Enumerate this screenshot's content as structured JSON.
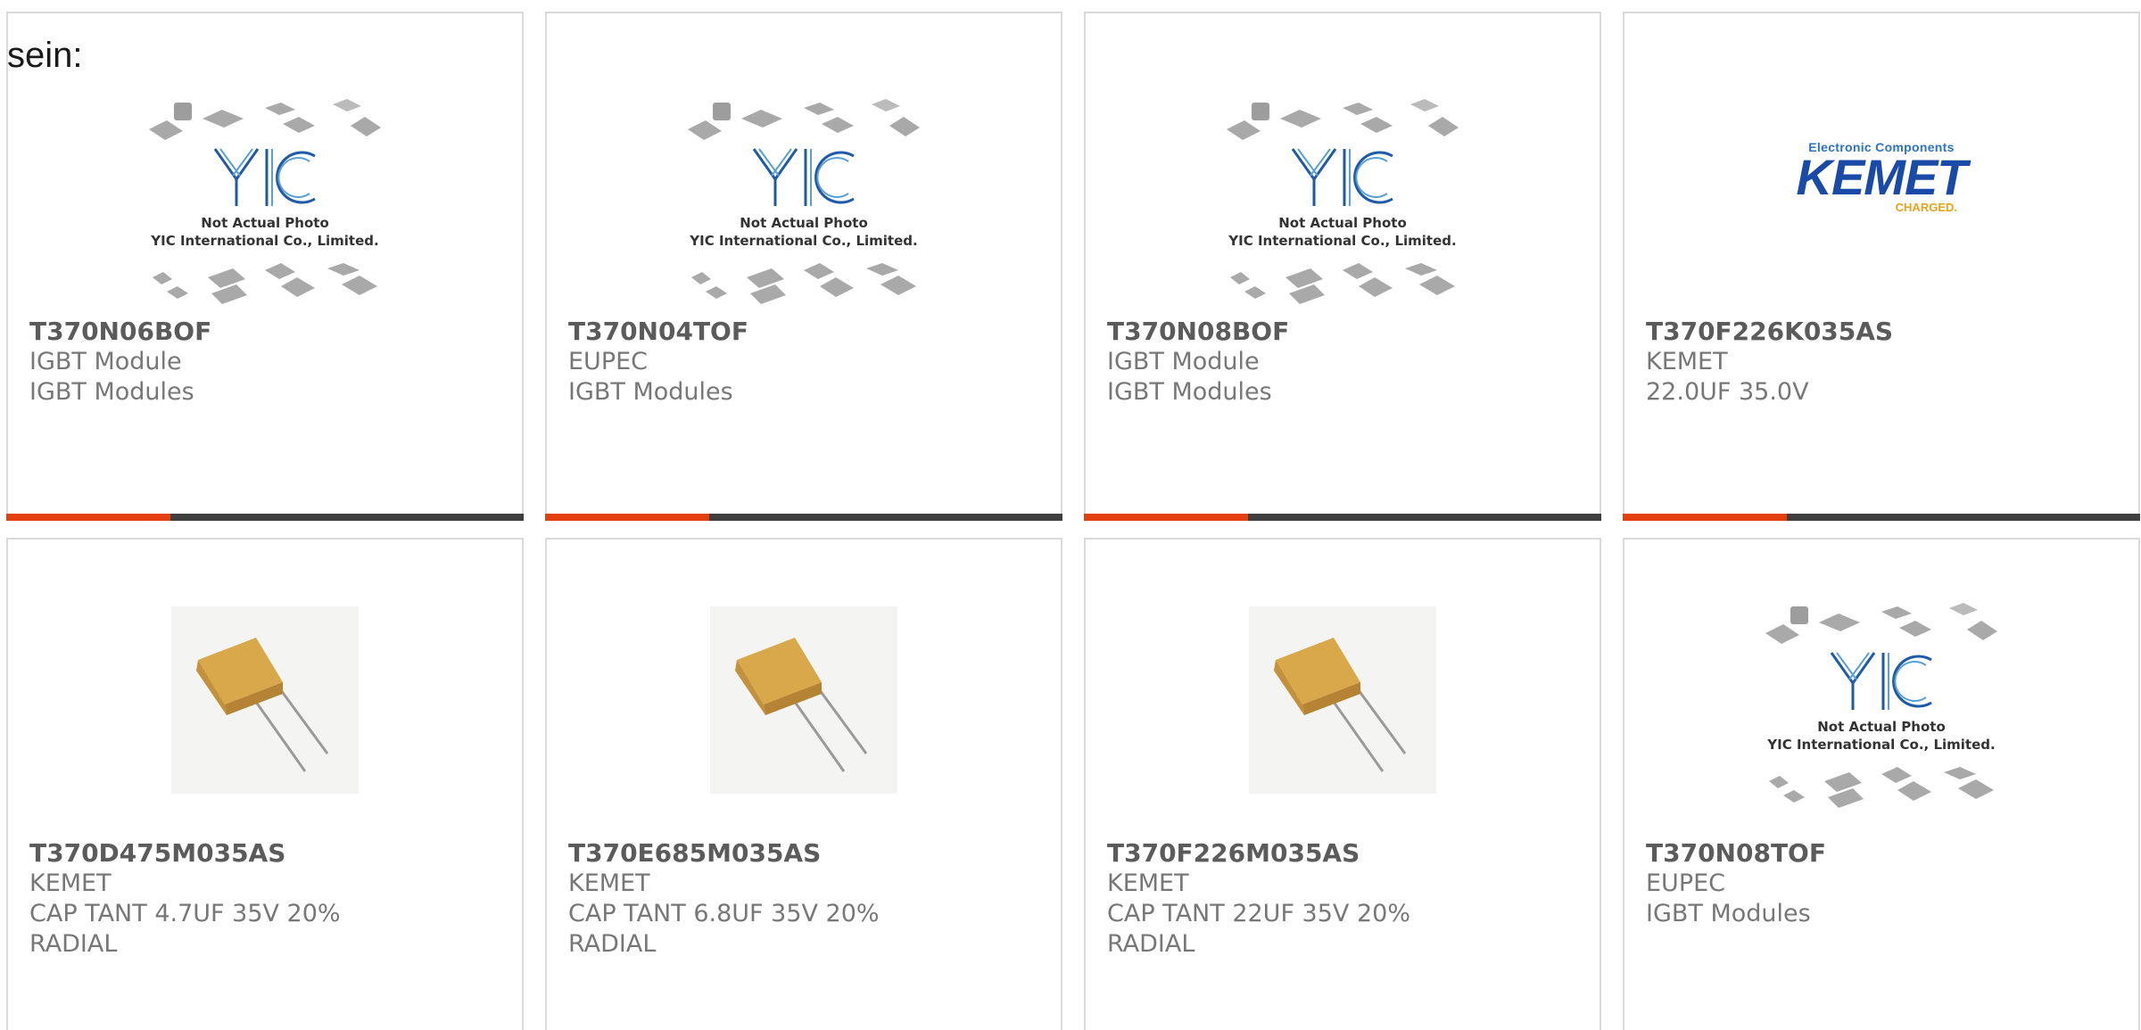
{
  "lead_text": "sein:",
  "colors": {
    "accent": "#e2400f",
    "bar": "#3f3f3f",
    "border": "#dadada",
    "text_muted": "#777777",
    "part_number": "#5b5b5b"
  },
  "placeholder_image": {
    "caption_line1": "Not Actual Photo",
    "caption_line2": "YIC International Co., Limited.",
    "logo_text": "YIC"
  },
  "kemet_logo": {
    "top": "Electronic Components",
    "name": "KEMET",
    "tagline": "CHARGED."
  },
  "products": [
    {
      "part": "T370N06BOF",
      "line1": "IGBT Module",
      "line2": "IGBT Modules",
      "line3": "",
      "image": "yic-placeholder"
    },
    {
      "part": "T370N04TOF",
      "line1": "EUPEC",
      "line2": "IGBT Modules",
      "line3": "",
      "image": "yic-placeholder"
    },
    {
      "part": "T370N08BOF",
      "line1": "IGBT Module",
      "line2": "IGBT Modules",
      "line3": "",
      "image": "yic-placeholder"
    },
    {
      "part": "T370F226K035AS",
      "line1": "KEMET",
      "line2": "22.0UF 35.0V",
      "line3": "",
      "image": "kemet-logo"
    },
    {
      "part": "T370D475M035AS",
      "line1": "KEMET",
      "line2": "CAP TANT 4.7UF 35V 20%",
      "line3": "RADIAL",
      "image": "tantalum-capacitor"
    },
    {
      "part": "T370E685M035AS",
      "line1": "KEMET",
      "line2": "CAP TANT 6.8UF 35V 20%",
      "line3": "RADIAL",
      "image": "tantalum-capacitor"
    },
    {
      "part": "T370F226M035AS",
      "line1": "KEMET",
      "line2": "CAP TANT 22UF 35V 20%",
      "line3": "RADIAL",
      "image": "tantalum-capacitor"
    },
    {
      "part": "T370N08TOF",
      "line1": "EUPEC",
      "line2": "IGBT Modules",
      "line3": "",
      "image": "yic-placeholder"
    }
  ]
}
